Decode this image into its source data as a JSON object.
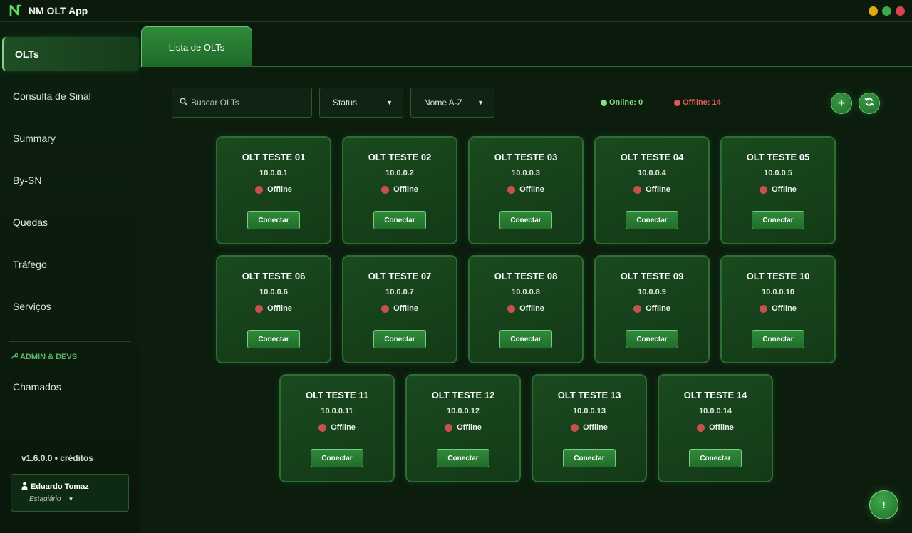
{
  "app": {
    "title": "NM OLT App"
  },
  "window": {
    "colors": {
      "minimize": "#e0a818",
      "maximize": "#3fa84a",
      "close": "#d64550"
    }
  },
  "sidebar": {
    "items": [
      {
        "label": "OLTs",
        "active": true
      },
      {
        "label": "Consulta de Sinal"
      },
      {
        "label": "Summary"
      },
      {
        "label": "By-SN"
      },
      {
        "label": "Quedas"
      },
      {
        "label": "Tráfego"
      },
      {
        "label": "Serviços"
      }
    ],
    "section_label": "ADMIN & DEVS",
    "admin_items": [
      {
        "label": "Chamados"
      }
    ],
    "version": "v1.6.0.0 • créditos",
    "user": {
      "name": "Eduardo Tomaz",
      "role": "Estagiário"
    }
  },
  "tabs": [
    {
      "label": "Lista de OLTs",
      "active": true
    }
  ],
  "toolbar": {
    "search_placeholder": "Buscar OLTs",
    "status_filter": "Status",
    "sort": "Nome A-Z",
    "online_label": "Online: 0",
    "offline_label": "Offline: 14",
    "online_color": "#7fe27f",
    "offline_color": "#e05a5a",
    "add_icon": "plus-icon",
    "refresh_icon": "refresh-icon"
  },
  "olts": [
    {
      "name": "OLT TESTE 01",
      "ip": "10.0.0.1",
      "status": "Offline",
      "action": "Conectar"
    },
    {
      "name": "OLT TESTE 02",
      "ip": "10.0.0.2",
      "status": "Offline",
      "action": "Conectar"
    },
    {
      "name": "OLT TESTE 03",
      "ip": "10.0.0.3",
      "status": "Offline",
      "action": "Conectar"
    },
    {
      "name": "OLT TESTE 04",
      "ip": "10.0.0.4",
      "status": "Offline",
      "action": "Conectar"
    },
    {
      "name": "OLT TESTE 05",
      "ip": "10.0.0.5",
      "status": "Offline",
      "action": "Conectar"
    },
    {
      "name": "OLT TESTE 06",
      "ip": "10.0.0.6",
      "status": "Offline",
      "action": "Conectar"
    },
    {
      "name": "OLT TESTE 07",
      "ip": "10.0.0.7",
      "status": "Offline",
      "action": "Conectar"
    },
    {
      "name": "OLT TESTE 08",
      "ip": "10.0.0.8",
      "status": "Offline",
      "action": "Conectar"
    },
    {
      "name": "OLT TESTE 09",
      "ip": "10.0.0.9",
      "status": "Offline",
      "action": "Conectar"
    },
    {
      "name": "OLT TESTE 10",
      "ip": "10.0.0.10",
      "status": "Offline",
      "action": "Conectar"
    },
    {
      "name": "OLT TESTE 11",
      "ip": "10.0.0.11",
      "status": "Offline",
      "action": "Conectar"
    },
    {
      "name": "OLT TESTE 12",
      "ip": "10.0.0.12",
      "status": "Offline",
      "action": "Conectar"
    },
    {
      "name": "OLT TESTE 13",
      "ip": "10.0.0.13",
      "status": "Offline",
      "action": "Conectar"
    },
    {
      "name": "OLT TESTE 14",
      "ip": "10.0.0.14",
      "status": "Offline",
      "action": "Conectar"
    }
  ],
  "help_label": "!"
}
